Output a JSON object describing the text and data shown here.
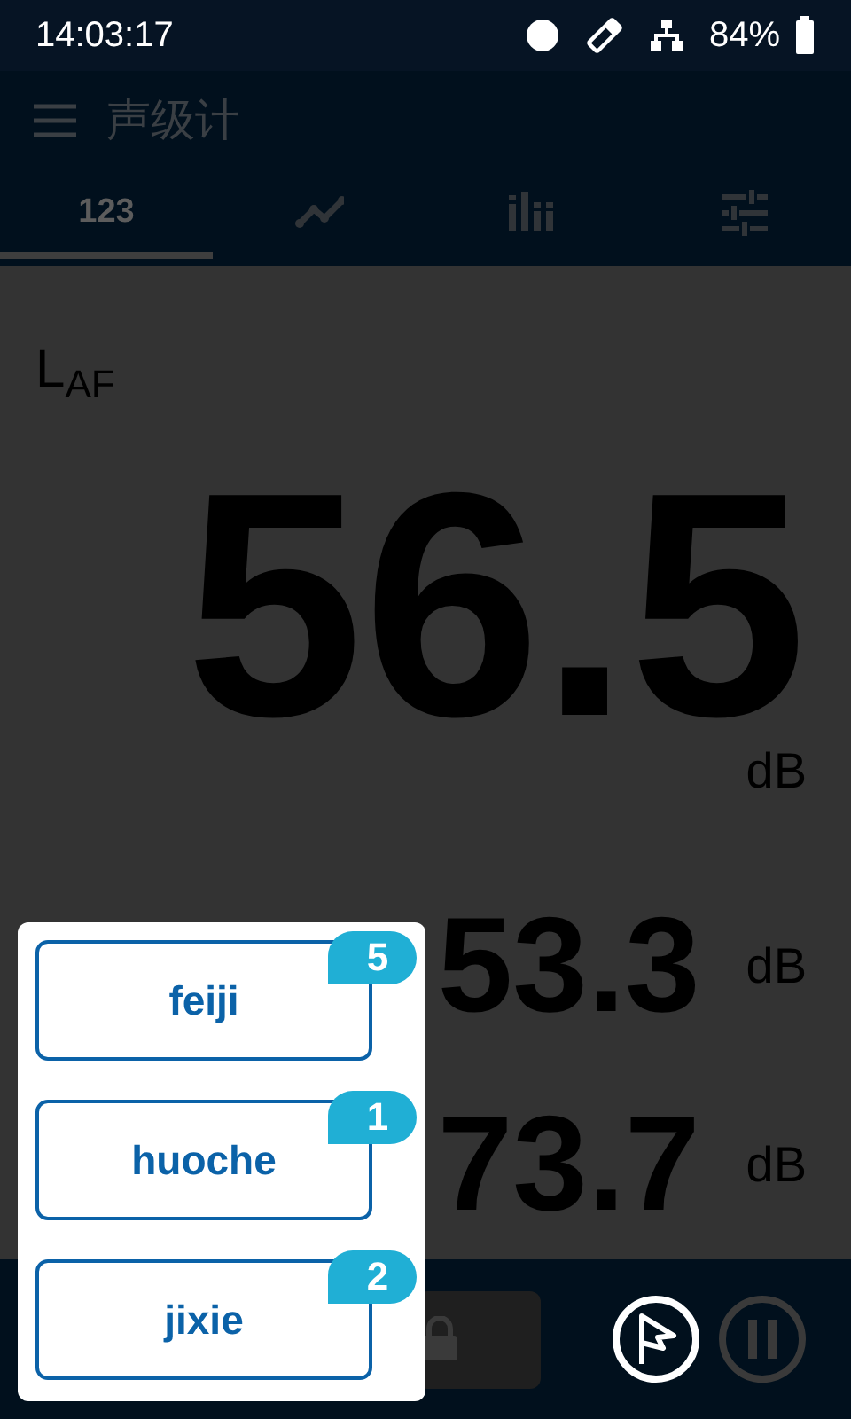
{
  "status_bar": {
    "time": "14:03:17",
    "battery": "84%"
  },
  "app_bar": {
    "title": "声级计"
  },
  "tabs": [
    {
      "kind": "text",
      "label": "123",
      "selected": true
    },
    {
      "kind": "line",
      "selected": false
    },
    {
      "kind": "bars",
      "selected": false
    },
    {
      "kind": "sliders",
      "selected": false
    }
  ],
  "main_reading": {
    "label": "L$_{AF}$",
    "value": "56.5",
    "unit": "dB"
  },
  "readings": [
    {
      "value": "53.3",
      "unit": "dB"
    },
    {
      "value": "73.7",
      "unit": "dB"
    }
  ],
  "popup": {
    "items": [
      {
        "label": "feiji",
        "count": "5"
      },
      {
        "label": "huoche",
        "count": "1"
      },
      {
        "label": "jixie",
        "count": "2"
      }
    ]
  }
}
